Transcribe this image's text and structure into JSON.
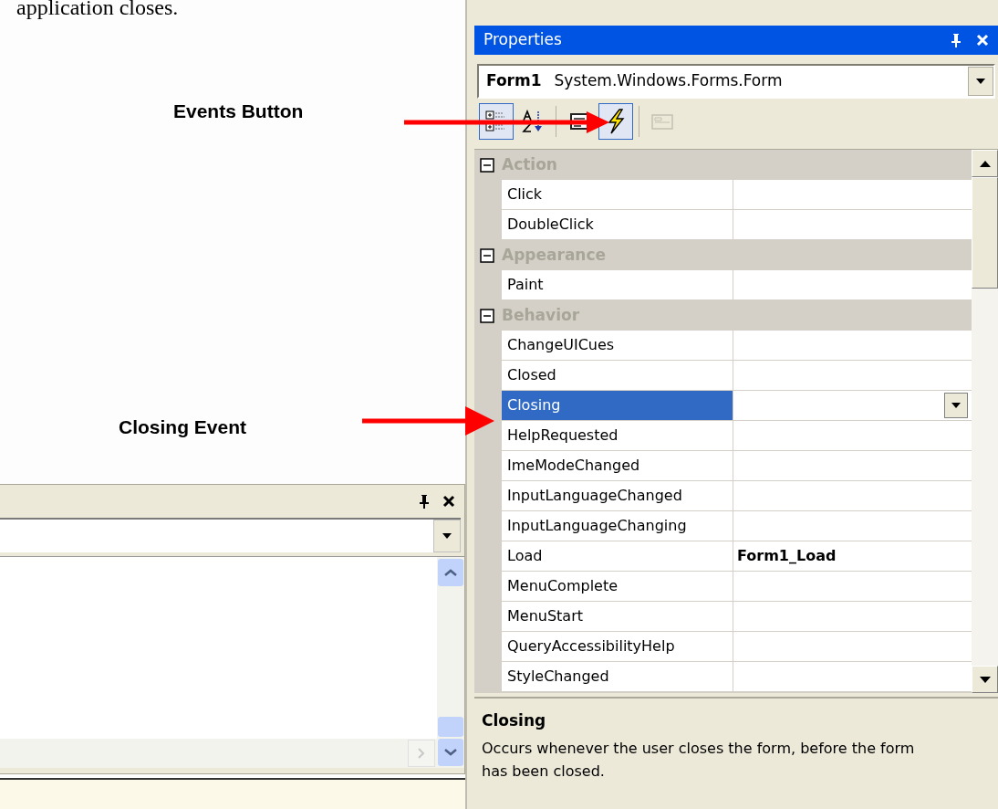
{
  "caption_fragment": "application closes.",
  "annotations": [
    {
      "label": "Events Button"
    },
    {
      "label": "Closing Event"
    }
  ],
  "properties": {
    "title": "Properties",
    "object": {
      "name": "Form1",
      "type": "System.Windows.Forms.Form"
    },
    "toolbar": [
      {
        "kind": "categorized",
        "selected": true,
        "disabled": false
      },
      {
        "kind": "alphabetical",
        "selected": false,
        "disabled": false
      },
      {
        "kind": "properties",
        "selected": false,
        "disabled": false
      },
      {
        "kind": "events",
        "selected": true,
        "disabled": false
      },
      {
        "kind": "pages",
        "selected": false,
        "disabled": true
      }
    ],
    "categories": [
      {
        "name": "Action",
        "expanded": true,
        "children": [
          {
            "name": "Click",
            "selected": false
          },
          {
            "name": "DoubleClick",
            "selected": false
          }
        ]
      },
      {
        "name": "Appearance",
        "expanded": true,
        "children": [
          {
            "name": "Paint",
            "selected": false
          }
        ]
      },
      {
        "name": "Behavior",
        "expanded": true,
        "children": [
          {
            "name": "ChangeUICues",
            "selected": false
          },
          {
            "name": "Closed",
            "selected": false
          },
          {
            "name": "Closing",
            "selected": true
          },
          {
            "name": "HelpRequested",
            "selected": false
          },
          {
            "name": "ImeModeChanged",
            "selected": false
          },
          {
            "name": "InputLanguageChanged",
            "selected": false
          },
          {
            "name": "InputLanguageChanging",
            "selected": false
          },
          {
            "name": "Load",
            "value": "Form1_Load",
            "selected": false
          },
          {
            "name": "MenuComplete",
            "selected": false
          },
          {
            "name": "MenuStart",
            "selected": false
          },
          {
            "name": "QueryAccessibilityHelp",
            "selected": false
          },
          {
            "name": "StyleChanged",
            "selected": false
          }
        ]
      }
    ],
    "description": {
      "title": "Closing",
      "text": "Occurs whenever the user closes the form, before the form has been closed."
    }
  }
}
